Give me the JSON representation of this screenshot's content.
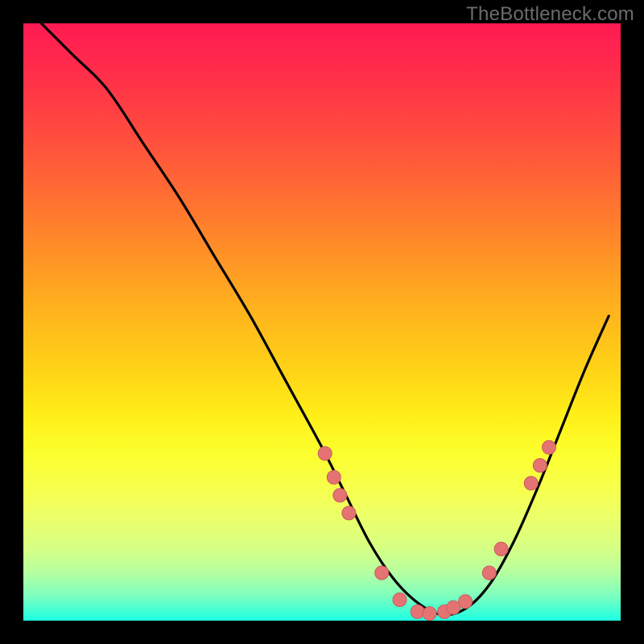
{
  "attribution": "TheBottleneck.com",
  "colors": {
    "background": "#000000",
    "gradient_top": "#ff1a52",
    "gradient_mid": "#ffe818",
    "gradient_bottom": "#1fffe0",
    "curve": "#000000",
    "dot_fill": "#e57373",
    "dot_stroke": "#cc5c5c"
  },
  "chart_data": {
    "type": "line",
    "title": "",
    "xlabel": "",
    "ylabel": "",
    "xlim": [
      0,
      100
    ],
    "ylim": [
      0,
      100
    ],
    "series": [
      {
        "name": "bottleneck-curve",
        "x": [
          3,
          8,
          14,
          20,
          26,
          32,
          38,
          44,
          50,
          54,
          58,
          62,
          66,
          70,
          74,
          78,
          82,
          86,
          90,
          94,
          98
        ],
        "y": [
          100,
          95,
          89,
          80,
          71,
          61,
          51,
          40,
          29,
          21,
          13,
          7,
          3,
          1,
          2,
          6,
          13,
          22,
          32,
          42,
          51
        ]
      }
    ],
    "markers": [
      {
        "x": 50.5,
        "y": 28
      },
      {
        "x": 52.0,
        "y": 24
      },
      {
        "x": 53.0,
        "y": 21
      },
      {
        "x": 54.5,
        "y": 18
      },
      {
        "x": 60.0,
        "y": 8
      },
      {
        "x": 63.0,
        "y": 3.5
      },
      {
        "x": 66.0,
        "y": 1.5
      },
      {
        "x": 68.0,
        "y": 1.2
      },
      {
        "x": 70.5,
        "y": 1.5
      },
      {
        "x": 72.0,
        "y": 2.2
      },
      {
        "x": 74.0,
        "y": 3.2
      },
      {
        "x": 78.0,
        "y": 8
      },
      {
        "x": 80.0,
        "y": 12
      },
      {
        "x": 85.0,
        "y": 23
      },
      {
        "x": 86.5,
        "y": 26
      },
      {
        "x": 88.0,
        "y": 29
      }
    ]
  }
}
